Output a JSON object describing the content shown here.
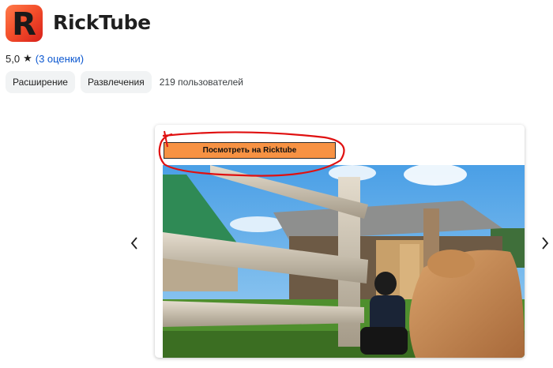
{
  "app": {
    "logo_letter": "R",
    "title": "RickTube"
  },
  "rating": {
    "score": "5,0",
    "star_icon": "star-icon",
    "reviews_link": "(3 оценки)"
  },
  "chips": {
    "type": "Расширение",
    "category": "Развлечения",
    "users": "219 пользователей"
  },
  "carousel": {
    "prev_icon": "chevron-left-icon",
    "next_icon": "chevron-right-icon",
    "slide": {
      "button_label": "Посмотреть на Ricktube",
      "button_color": "#f79243",
      "annotation_color": "#e01010"
    }
  }
}
